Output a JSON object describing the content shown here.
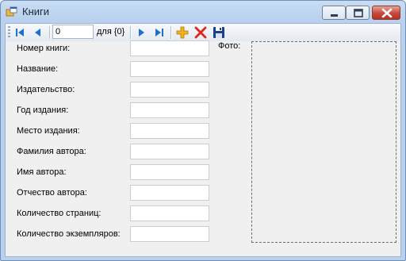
{
  "window": {
    "title": "Книги",
    "icons": {
      "app": "app-window-icon",
      "minimize": "minimize-icon",
      "maximize": "maximize-icon",
      "close": "close-icon"
    }
  },
  "toolbar": {
    "position_value": "0",
    "count_label": "для {0}",
    "icons": [
      "move-first-icon",
      "move-previous-icon",
      "move-next-icon",
      "move-last-icon",
      "add-new-icon",
      "delete-icon",
      "save-icon"
    ]
  },
  "form": {
    "fields": [
      {
        "label": "Номер книги:",
        "value": ""
      },
      {
        "label": "Название:",
        "value": ""
      },
      {
        "label": "Издательство:",
        "value": ""
      },
      {
        "label": "Год издания:",
        "value": ""
      },
      {
        "label": "Место издания:",
        "value": ""
      },
      {
        "label": "Фамилия автора:",
        "value": ""
      },
      {
        "label": "Имя автора:",
        "value": ""
      },
      {
        "label": "Отчество автора:",
        "value": ""
      },
      {
        "label": "Количество страниц:",
        "value": ""
      },
      {
        "label": "Количество экземпляров:",
        "value": ""
      }
    ],
    "photo_label": "Фото:"
  },
  "colors": {
    "accent": "#1f6fcf",
    "close": "#c8463a",
    "add": "#f2b21a",
    "delete": "#e0261c",
    "save": "#1b3f8f"
  }
}
